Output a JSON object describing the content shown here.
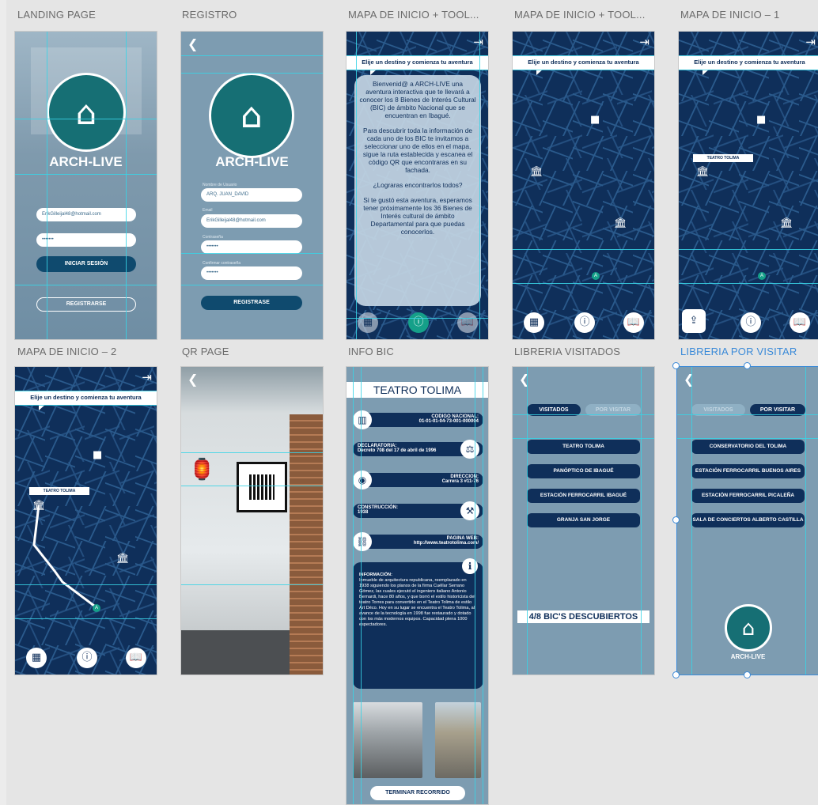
{
  "artboards": {
    "landing": "LANDING PAGE",
    "registro": "REGISTRO",
    "mapa_tool_1": "MAPA DE INICIO + TOOL...",
    "mapa_tool_2": "MAPA DE INICIO + TOOL...",
    "mapa_1": "MAPA DE INICIO – 1",
    "mapa_2": "MAPA DE INICIO – 2",
    "qr": "QR PAGE",
    "info": "INFO BIC",
    "lib_visitados": "LIBRERIA VISITADOS",
    "lib_por_visitar": "LIBRERIA POR VISITAR"
  },
  "brand": "ARCH-LIVE",
  "landing": {
    "email_value": "ErikGilleijal48@hotmail.com",
    "password_value": "•••••••",
    "login_button": "INICIAR SESIÓN",
    "register_button": "REGISTRARSE"
  },
  "registro": {
    "username_label": "Nombre de Usuario",
    "username_value": "ARQ. JUAN_DAVID",
    "email_label": "Email",
    "email_value": "ErikGilleijal48@hotmail.com",
    "password_label": "Contraseña",
    "password_value": "•••••••",
    "confirm_label": "Confirmar contraseña",
    "confirm_value": "•••••••",
    "submit_button": "REGISTRASE"
  },
  "map": {
    "banner": "Elije un destino y comienza tu aventura",
    "teatro_label": "TEATRO TOLIMA",
    "welcome_text": [
      "Bienvenid@ a ARCH-LIVE una aventura interactiva que te llevará a conocer los 8 Bienes de Interés Cultural (BIC) de ámbito Nacional que se encuentran en Ibagué.",
      "Para descubrir toda la información de cada uno de los BIC te invitamos a seleccionar uno de ellos en el mapa, sigue la ruta establecida y escanea el código QR que encontraras en su fachada.",
      "¿Lograras encontrarlos todos?",
      "Si te gustó esta aventura, esperamos tener próximamente los 36 Bienes de Interés cultural de ámbito Departamental para que puedas conocerlos."
    ]
  },
  "info": {
    "title": "TEATRO TOLIMA",
    "codigo_label": "CODIGO NACIONAL:",
    "codigo_value": "01-01-01-04-73-001-000004",
    "declaratoria_label": "DECLARATORIA:",
    "declaratoria_value": "Decreto 708 del 17 de abril de 1996",
    "direccion_label": "DIRECCION:",
    "direccion_value": "Carrera 3 #11-76",
    "construccion_label": "CONSTRUCCIÓN:",
    "construccion_value": "1938",
    "web_label": "PAGINA WEB:",
    "web_value": "http://www.teatrotolima.com/",
    "informacion_label": "INFORMACIÓN:",
    "informacion_text": "Inmueble de arquitectura republicana, reemplazado en 1938 siguiendo los planos de la firma Cuéllar Serrano Gómez, las cuales ejecutó el ingeniero italiano Antonio Bernardi, hace 80 años, y que borró el estilo historicista del teatro Torres para convertirlo en el Teatro Tolima de estilo Art Déco. Hoy en su lugar se encuentra el Teatro Tolima, al avance de la tecnología en 1998 fue restaurado y dotado con los más modernos equipos. Capacidad plena 1000 espectadores.",
    "end_button": "TERMINAR RECORRIDO"
  },
  "library": {
    "tab_visitados": "VISITADOS",
    "tab_por_visitar": "POR VISITAR",
    "visitados": [
      "TEATRO TOLIMA",
      "PANÓPTICO DE IBAGUÉ",
      "ESTACIÓN FERROCARRIL IBAGUÉ",
      "GRANJA SAN JORGE"
    ],
    "counter": "4/8 BIC'S DESCUBIERTOS",
    "por_visitar": [
      "CONSERVATORIO DEL TOLIMA",
      "ESTACIÓN FERROCARRIL BUENOS AIRES",
      "ESTACIÓN FERROCARRIL PICALEÑA",
      "SALA DE CONCIERTOS ALBERTO CASTILLA"
    ]
  },
  "colors": {
    "primary_navy": "#0f2f5a",
    "teal": "#166f74",
    "guide": "#38d4e6",
    "selection": "#3b8ad8"
  }
}
